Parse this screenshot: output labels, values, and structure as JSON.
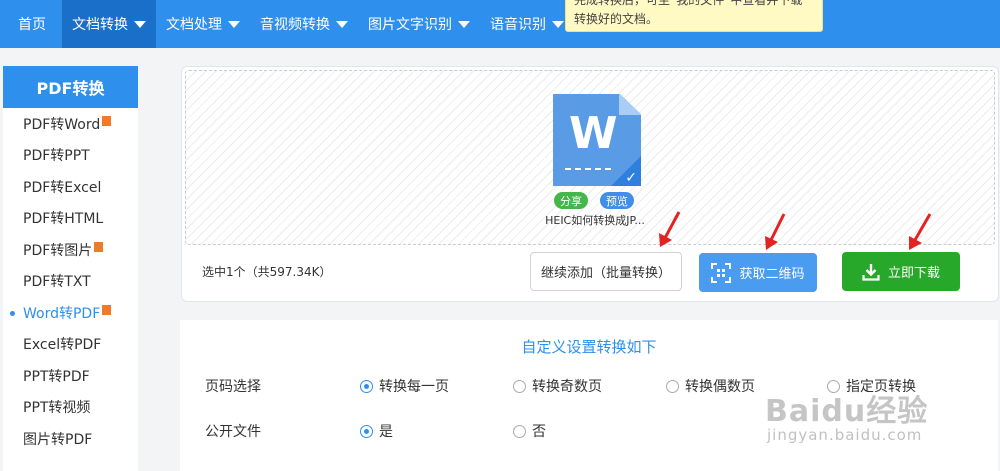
{
  "nav": {
    "items": [
      {
        "label": "首页",
        "caret": false
      },
      {
        "label": "文档转换",
        "caret": true,
        "active": true
      },
      {
        "label": "文档处理",
        "caret": true
      },
      {
        "label": "音视频转换",
        "caret": true
      },
      {
        "label": "图片文字识别",
        "caret": true
      },
      {
        "label": "语音识别",
        "caret": true
      }
    ],
    "tooltip_lines": [
      "完成转换后，可至“我的文件”中查看并下载",
      "转换好的文档。"
    ]
  },
  "sidebar": {
    "title": "PDF转换",
    "items": [
      {
        "label": "PDF转Word",
        "tag": true
      },
      {
        "label": "PDF转PPT"
      },
      {
        "label": "PDF转Excel"
      },
      {
        "label": "PDF转HTML"
      },
      {
        "label": "PDF转图片",
        "tag": true
      },
      {
        "label": "PDF转TXT"
      },
      {
        "label": "Word转PDF",
        "tag": true,
        "active": true
      },
      {
        "label": "Excel转PDF"
      },
      {
        "label": "PPT转PDF"
      },
      {
        "label": "PPT转视频"
      },
      {
        "label": "图片转PDF"
      }
    ]
  },
  "upload": {
    "file": {
      "name": "HEIC如何转换成JP...",
      "icon": "word-doc-icon",
      "share_label": "分享",
      "preview_label": "预览",
      "doc_letter": "W"
    },
    "selection_info": "选中1个（共597.34K）",
    "add_button": "继续添加（批量转换）",
    "qr_button": "获取二维码",
    "download_button": "立即下载"
  },
  "settings": {
    "title": "自定义设置转换如下",
    "page_label": "页码选择",
    "page_options": [
      {
        "label": "转换每一页",
        "selected": true
      },
      {
        "label": "转换奇数页",
        "selected": false
      },
      {
        "label": "转换偶数页",
        "selected": false
      },
      {
        "label": "指定页转换",
        "selected": false
      }
    ],
    "public_label": "公开文件",
    "public_options": [
      {
        "label": "是",
        "selected": true
      },
      {
        "label": "否",
        "selected": false
      }
    ]
  },
  "watermark": {
    "logo": "Baidu经验",
    "url": "jingyan.baidu.com"
  },
  "colors": {
    "primary": "#2f8fec",
    "nav_active": "#1a6fc9",
    "download": "#27a82a",
    "qr": "#4a9cf0",
    "arrow": "#e52222"
  }
}
